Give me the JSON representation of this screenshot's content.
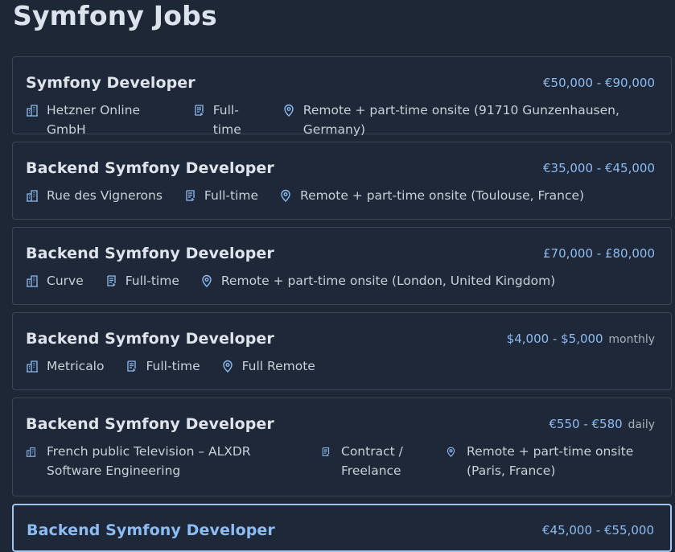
{
  "page": {
    "title": "Symfony Jobs"
  },
  "colors": {
    "background": "#1e2736",
    "accent": "#8cbcf2",
    "border": "#3a4556",
    "active_border": "#9ec4ef"
  },
  "jobs": [
    {
      "title": "Symfony Developer",
      "salary": "€50,000 - €90,000",
      "period": "",
      "company": "Hetzner Online GmbH",
      "type": "Full-time",
      "location": "Remote + part-time onsite (91710 Gunzenhausen, Germany)"
    },
    {
      "title": "Backend Symfony Developer",
      "salary": "€35,000 - €45,000",
      "period": "",
      "company": "Rue des Vignerons",
      "type": "Full-time",
      "location": "Remote + part-time onsite (Toulouse, France)"
    },
    {
      "title": "Backend Symfony Developer",
      "salary": "£70,000 - £80,000",
      "period": "",
      "company": "Curve",
      "type": "Full-time",
      "location": "Remote + part-time onsite (London, United Kingdom)"
    },
    {
      "title": "Backend Symfony Developer",
      "salary": "$4,000 - $5,000",
      "period": "monthly",
      "company": "Metricalo",
      "type": "Full-time",
      "location": "Full Remote"
    },
    {
      "title": "Backend Symfony Developer",
      "salary": "€550 - €580",
      "period": "daily",
      "company": "French public Television – ALXDR Software Engineering",
      "type": "Contract / Freelance",
      "location": "Remote + part-time onsite (Paris, France)"
    },
    {
      "title": "Backend Symfony Developer",
      "salary": "€45,000 - €55,000",
      "period": "",
      "company": "",
      "type": "",
      "location": ""
    }
  ],
  "icons": {
    "company": "building-icon",
    "type": "contract-icon",
    "location": "map-pin-icon"
  }
}
